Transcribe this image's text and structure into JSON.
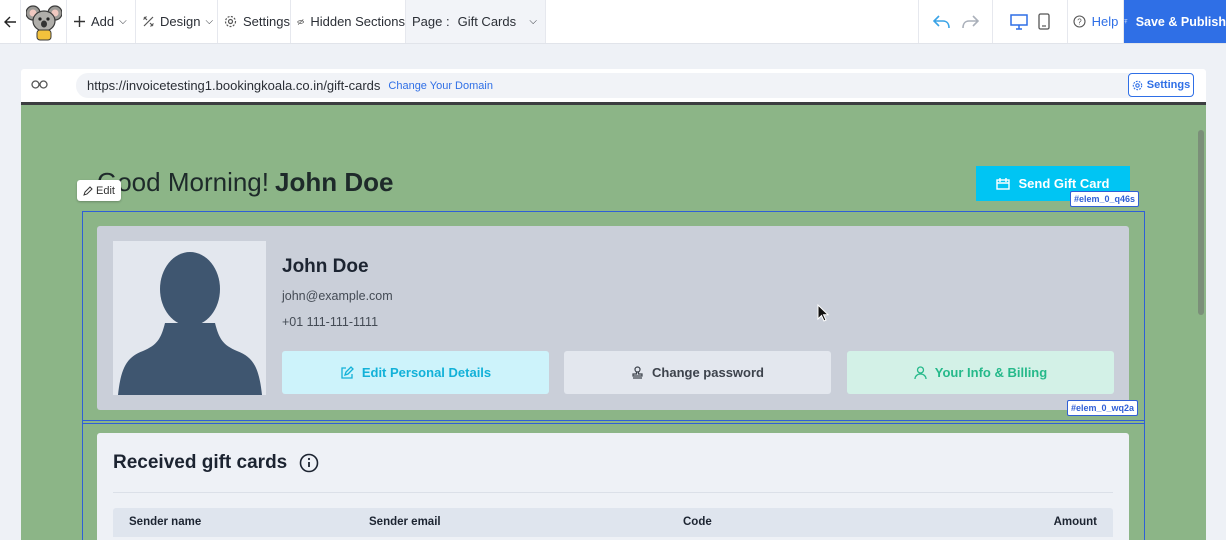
{
  "toolbar": {
    "add_label": "Add",
    "design_label": "Design",
    "settings_label": "Settings",
    "hidden_sections_label": "Hidden Sections",
    "page_prefix": "Page :",
    "page_value": "Gift Cards",
    "help_label": "Help",
    "publish_label": "Save & Publish",
    "accent": "#2f6fe6"
  },
  "urlbar": {
    "url": "https://invoicetesting1.bookingkoala.co.in/gift-cards",
    "change_domain": "Change Your Domain",
    "settings_label": "Settings"
  },
  "canvas": {
    "background": "#8cb587",
    "edit_chip": "Edit",
    "greeting": "Good Morning!",
    "greeting_name": "John Doe",
    "send_gift_card": "Send Gift Card",
    "tag_send": "#elem_0_q46s",
    "tag_profile": "#elem_0_wq2a",
    "profile": {
      "name": "John Doe",
      "email": "john@example.com",
      "phone": "+01 111-111-1111",
      "btn_edit": "Edit Personal Details",
      "btn_password": "Change password",
      "btn_info": "Your Info & Billing"
    },
    "gift": {
      "title": "Received gift cards",
      "columns": [
        "Sender name",
        "Sender email",
        "Code",
        "Amount"
      ]
    }
  }
}
